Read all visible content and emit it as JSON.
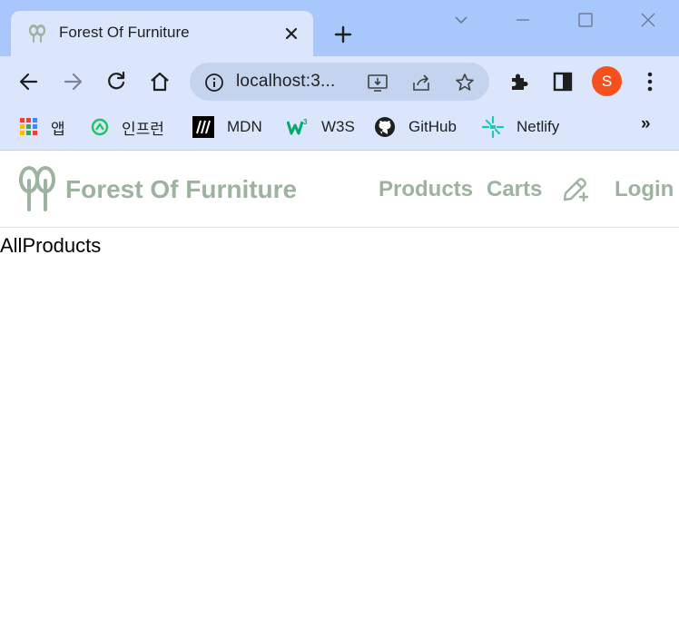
{
  "browser": {
    "tab_title": "Forest Of Furniture",
    "address": "localhost:3...",
    "profile_initial": "S",
    "bookmarks": [
      {
        "label": "앱"
      },
      {
        "label": "인프런"
      },
      {
        "label": "MDN"
      },
      {
        "label": "W3S"
      },
      {
        "label": "GitHub"
      },
      {
        "label": "Netlify"
      }
    ],
    "more_bookmarks": "»"
  },
  "site": {
    "brand": "Forest Of Furniture",
    "nav": {
      "products": "Products",
      "carts": "Carts",
      "login": "Login"
    },
    "main_text": "AllProducts"
  },
  "colors": {
    "brand": "#9db3a0",
    "titlebar": "#a8c7fa",
    "toolbar": "#dbe6fd",
    "avatar": "#f4511e"
  }
}
